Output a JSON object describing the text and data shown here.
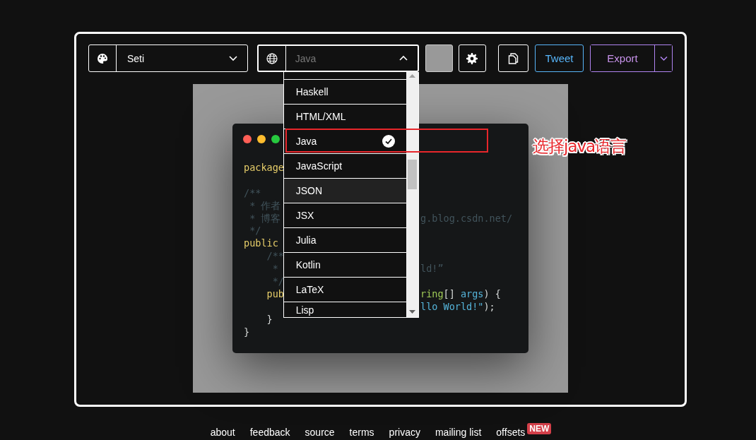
{
  "theme_select": {
    "value": "Seti",
    "expanded": false
  },
  "language_select": {
    "value": "Java",
    "expanded": true,
    "options": [
      {
        "label": "Haskell",
        "selected": false,
        "highlighted": false
      },
      {
        "label": "HTML/XML",
        "selected": false,
        "highlighted": false
      },
      {
        "label": "Java",
        "selected": true,
        "highlighted": false
      },
      {
        "label": "JavaScript",
        "selected": false,
        "highlighted": false
      },
      {
        "label": "JSON",
        "selected": false,
        "highlighted": true
      },
      {
        "label": "JSX",
        "selected": false,
        "highlighted": false
      },
      {
        "label": "Julia",
        "selected": false,
        "highlighted": false
      },
      {
        "label": "Kotlin",
        "selected": false,
        "highlighted": false
      },
      {
        "label": "LaTeX",
        "selected": false,
        "highlighted": false
      },
      {
        "label": "Lisp",
        "selected": false,
        "highlighted": false
      }
    ]
  },
  "buttons": [
    {
      "kind": "tweet",
      "label": "Tweet"
    },
    {
      "kind": "export",
      "label": "Export"
    }
  ],
  "code_window": {
    "blocks": [
      {
        "lines": [
          {
            "left": [
              {
                "text": "package",
                "kind": "keyword"
              }
            ]
          }
        ]
      },
      {
        "lines": [
          {
            "left": [
              {
                "text": "/**",
                "kind": "comment"
              }
            ]
          },
          {
            "left": [
              {
                "text": " * 作者",
                "kind": "comment"
              }
            ]
          },
          {
            "left": [
              {
                "text": " * 博客",
                "kind": "comment"
              }
            ],
            "right": [
              {
                "text": "g.blog.csdn.net/",
                "kind": "comment"
              }
            ]
          },
          {
            "left": [
              {
                "text": " */",
                "kind": "comment"
              }
            ]
          },
          {
            "left": [
              {
                "text": "public",
                "kind": "keyword"
              }
            ]
          },
          {
            "left": [
              {
                "text": "    /**",
                "kind": "comment"
              }
            ]
          },
          {
            "left": [
              {
                "text": "     *",
                "kind": "comment"
              }
            ],
            "right": [
              {
                "text": "ld!”",
                "kind": "comment"
              }
            ]
          },
          {
            "left": [
              {
                "text": "     */",
                "kind": "comment"
              }
            ]
          },
          {
            "left": [
              {
                "text": "    pub",
                "kind": "keyword"
              }
            ],
            "right": [
              {
                "text": "ring",
                "kind": "type"
              },
              {
                "text": "[] ",
                "kind": "plain"
              },
              {
                "text": "args",
                "kind": "variable"
              },
              {
                "text": ") {",
                "kind": "plain"
              }
            ]
          },
          {
            "right": [
              {
                "text": "llo World!\"",
                "kind": "string"
              },
              {
                "text": ");",
                "kind": "plain"
              }
            ]
          },
          {
            "left": [
              {
                "text": "    }",
                "kind": "plain"
              }
            ]
          },
          {
            "left": [
              {
                "text": "}",
                "kind": "plain"
              }
            ]
          }
        ]
      }
    ]
  },
  "annotation": {
    "text": "选择java语言"
  },
  "footer": {
    "links": [
      {
        "label": "about"
      },
      {
        "label": "feedback"
      },
      {
        "label": "source"
      },
      {
        "label": "terms"
      },
      {
        "label": "privacy"
      },
      {
        "label": "mailing list"
      },
      {
        "label": "offsets",
        "badge": "NEW"
      }
    ]
  }
}
